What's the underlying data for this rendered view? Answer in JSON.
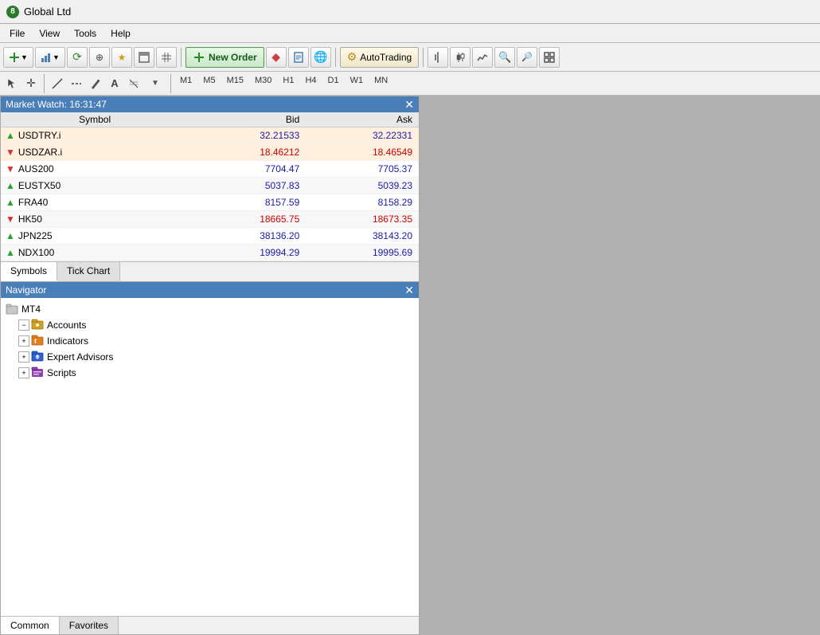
{
  "titleBar": {
    "icon": "8",
    "title": "Global Ltd"
  },
  "menuBar": {
    "items": [
      "File",
      "View",
      "Tools",
      "Help"
    ]
  },
  "toolbar": {
    "newOrderLabel": "New Order",
    "autoTradingLabel": "AutoTrading",
    "timeframes": [
      "M1",
      "M5",
      "M15",
      "M30",
      "H1",
      "H4",
      "D1",
      "W1",
      "MN"
    ]
  },
  "marketWatch": {
    "title": "Market Watch: 16:31:47",
    "headers": [
      "Symbol",
      "Bid",
      "Ask"
    ],
    "rows": [
      {
        "symbol": "USDTRY.i",
        "bid": "32.21533",
        "ask": "32.22331",
        "direction": "up",
        "highlighted": true,
        "bidColor": "blue",
        "askColor": "blue"
      },
      {
        "symbol": "USDZAR.i",
        "bid": "18.46212",
        "ask": "18.46549",
        "direction": "down",
        "highlighted": true,
        "bidColor": "red",
        "askColor": "red"
      },
      {
        "symbol": "AUS200",
        "bid": "7704.47",
        "ask": "7705.37",
        "direction": "down",
        "highlighted": false,
        "bidColor": "blue",
        "askColor": "blue"
      },
      {
        "symbol": "EUSTX50",
        "bid": "5037.83",
        "ask": "5039.23",
        "direction": "up",
        "highlighted": false,
        "bidColor": "blue",
        "askColor": "blue"
      },
      {
        "symbol": "FRA40",
        "bid": "8157.59",
        "ask": "8158.29",
        "direction": "up",
        "highlighted": false,
        "bidColor": "blue",
        "askColor": "blue"
      },
      {
        "symbol": "HK50",
        "bid": "18665.75",
        "ask": "18673.35",
        "direction": "down",
        "highlighted": false,
        "bidColor": "red",
        "askColor": "red"
      },
      {
        "symbol": "JPN225",
        "bid": "38136.20",
        "ask": "38143.20",
        "direction": "up",
        "highlighted": false,
        "bidColor": "blue",
        "askColor": "blue"
      },
      {
        "symbol": "NDX100",
        "bid": "19994.29",
        "ask": "19995.69",
        "direction": "up",
        "highlighted": false,
        "bidColor": "blue",
        "askColor": "blue"
      }
    ],
    "tabs": [
      {
        "label": "Symbols",
        "active": true
      },
      {
        "label": "Tick Chart",
        "active": false
      }
    ]
  },
  "navigator": {
    "title": "Navigator",
    "tree": [
      {
        "label": "MT4",
        "indent": 0,
        "expandable": false,
        "type": "root"
      },
      {
        "label": "Accounts",
        "indent": 1,
        "expandable": true,
        "type": "folder"
      },
      {
        "label": "Indicators",
        "indent": 1,
        "expandable": true,
        "type": "indicators"
      },
      {
        "label": "Expert Advisors",
        "indent": 1,
        "expandable": true,
        "type": "ea"
      },
      {
        "label": "Scripts",
        "indent": 1,
        "expandable": true,
        "type": "scripts"
      }
    ],
    "tabs": [
      {
        "label": "Common",
        "active": true
      },
      {
        "label": "Favorites",
        "active": false
      }
    ]
  }
}
